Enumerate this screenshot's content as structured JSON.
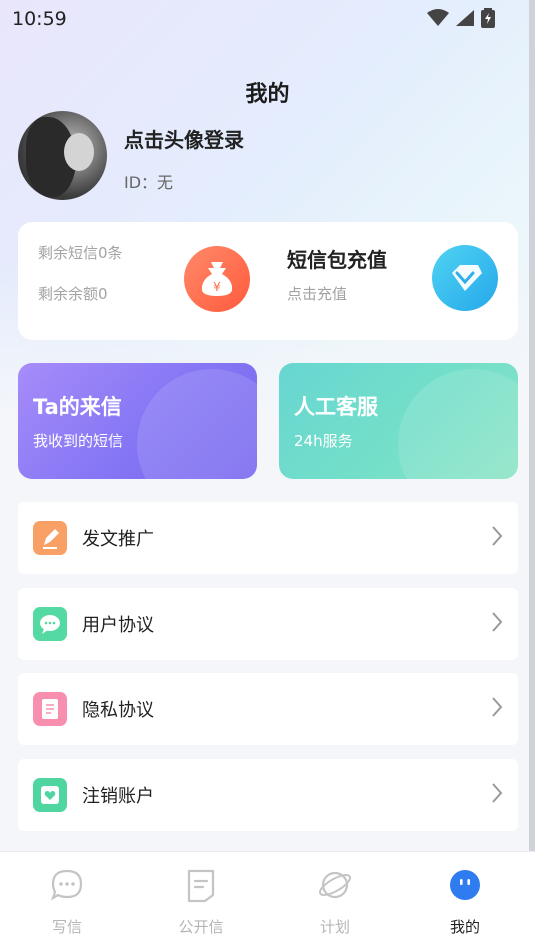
{
  "status_bar": {
    "time": "10:59"
  },
  "header": {
    "title": "我的"
  },
  "profile": {
    "login_text": "点击头像登录",
    "id_text": "ID：无"
  },
  "balance_card": {
    "remaining_sms": "剩余短信0条",
    "remaining_balance": "剩余余额0",
    "money_icon": "money-bag-icon",
    "recharge_title": "短信包充值",
    "recharge_sub": "点击充值",
    "diamond_icon": "diamond-icon"
  },
  "tiles": [
    {
      "title": "Ta的来信",
      "subtitle": "我收到的短信"
    },
    {
      "title": "人工客服",
      "subtitle": "24h服务"
    }
  ],
  "menu": [
    {
      "label": "发文推广",
      "icon": "pencil-icon",
      "color": "#f9a066"
    },
    {
      "label": "用户协议",
      "icon": "chat-bubble-icon",
      "color": "#55d9a2"
    },
    {
      "label": "隐私协议",
      "icon": "document-icon",
      "color": "#f98fae"
    },
    {
      "label": "注销账户",
      "icon": "heart-box-icon",
      "color": "#4fd6a0"
    }
  ],
  "tabbar": {
    "items": [
      {
        "label": "写信",
        "icon": "chat-icon"
      },
      {
        "label": "公开信",
        "icon": "letter-icon"
      },
      {
        "label": "计划",
        "icon": "planet-icon"
      },
      {
        "label": "我的",
        "icon": "profile-face-icon"
      }
    ],
    "active_color": "#2f7bf0"
  }
}
